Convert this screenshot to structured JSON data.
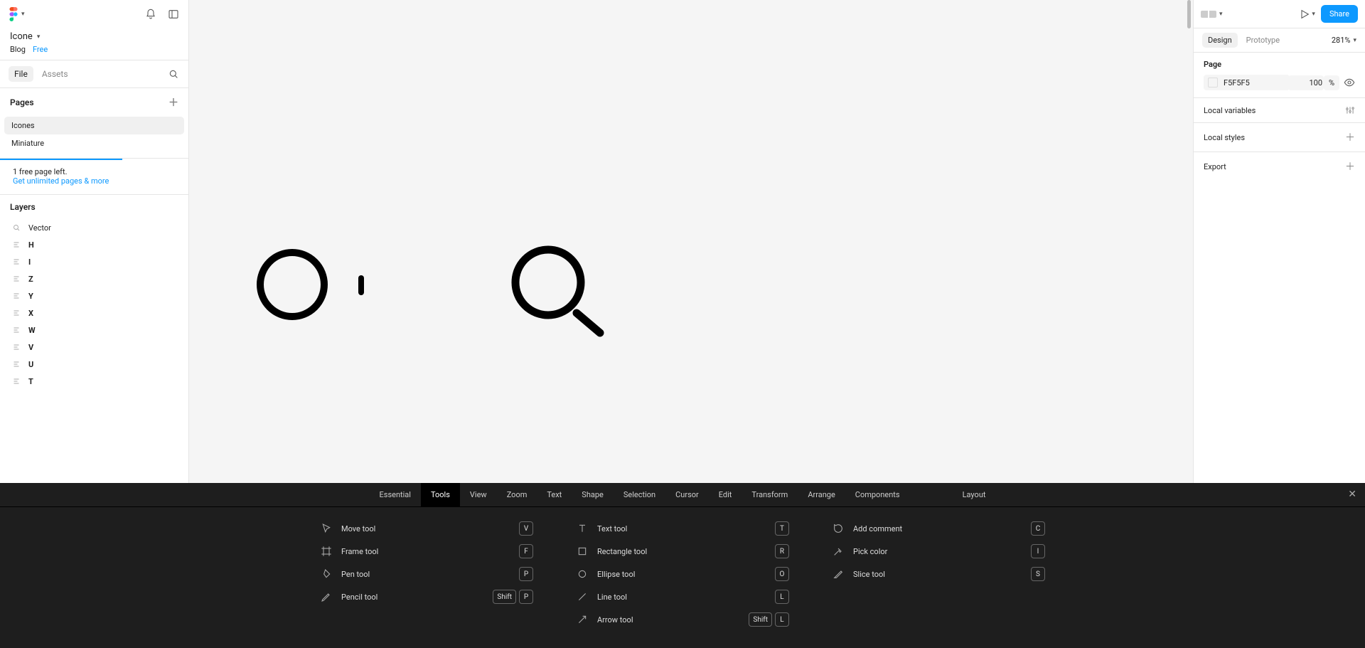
{
  "file": {
    "title": "Icone",
    "breadcrumb_project": "Blog",
    "breadcrumb_plan": "Free"
  },
  "leftPanel": {
    "tabs": {
      "file": "File",
      "assets": "Assets"
    },
    "pagesHeader": "Pages",
    "pages": [
      "Icones",
      "Miniature"
    ],
    "activePage": 0,
    "quota_line1": "1 free page left.",
    "quota_link": "Get unlimited pages & more",
    "layersHeader": "Layers",
    "layers": [
      {
        "icon": "vector",
        "label": "Vector",
        "bold": false
      },
      {
        "icon": "text",
        "label": "H",
        "bold": true
      },
      {
        "icon": "text",
        "label": "I",
        "bold": true
      },
      {
        "icon": "text",
        "label": "Z",
        "bold": true
      },
      {
        "icon": "text",
        "label": "Y",
        "bold": true
      },
      {
        "icon": "text",
        "label": "X",
        "bold": true
      },
      {
        "icon": "text",
        "label": "W",
        "bold": true
      },
      {
        "icon": "text",
        "label": "V",
        "bold": true
      },
      {
        "icon": "text",
        "label": "U",
        "bold": true
      },
      {
        "icon": "text",
        "label": "T",
        "bold": true
      }
    ]
  },
  "rightPanel": {
    "tabs": {
      "design": "Design",
      "prototype": "Prototype"
    },
    "zoom": "281%",
    "share": "Share",
    "pageSection": {
      "title": "Page",
      "fillHex": "F5F5F5",
      "fillOpacity": "100",
      "fillUnit": "%"
    },
    "localVariables": "Local variables",
    "localStyles": "Local styles",
    "export": "Export"
  },
  "shortcuts": {
    "tabs": [
      "Essential",
      "Tools",
      "View",
      "Zoom",
      "Text",
      "Shape",
      "Selection",
      "Cursor",
      "Edit",
      "Transform",
      "Arrange",
      "Components"
    ],
    "tabRight": "Layout",
    "activeTab": 1,
    "col1": [
      {
        "icon": "move",
        "label": "Move tool",
        "keys": [
          "V"
        ]
      },
      {
        "icon": "frame",
        "label": "Frame tool",
        "keys": [
          "F"
        ]
      },
      {
        "icon": "pen",
        "label": "Pen tool",
        "keys": [
          "P"
        ]
      },
      {
        "icon": "pencil",
        "label": "Pencil tool",
        "keys": [
          "Shift",
          "P"
        ]
      }
    ],
    "col2": [
      {
        "icon": "text",
        "label": "Text tool",
        "keys": [
          "T"
        ]
      },
      {
        "icon": "rect",
        "label": "Rectangle tool",
        "keys": [
          "R"
        ]
      },
      {
        "icon": "ellipse",
        "label": "Ellipse tool",
        "keys": [
          "O"
        ]
      },
      {
        "icon": "line",
        "label": "Line tool",
        "keys": [
          "L"
        ]
      },
      {
        "icon": "arrow",
        "label": "Arrow tool",
        "keys": [
          "Shift",
          "L"
        ]
      }
    ],
    "col3": [
      {
        "icon": "comment",
        "label": "Add comment",
        "keys": [
          "C"
        ]
      },
      {
        "icon": "eyedrop",
        "label": "Pick color",
        "keys": [
          "I"
        ]
      },
      {
        "icon": "slice",
        "label": "Slice tool",
        "keys": [
          "S"
        ]
      }
    ]
  }
}
